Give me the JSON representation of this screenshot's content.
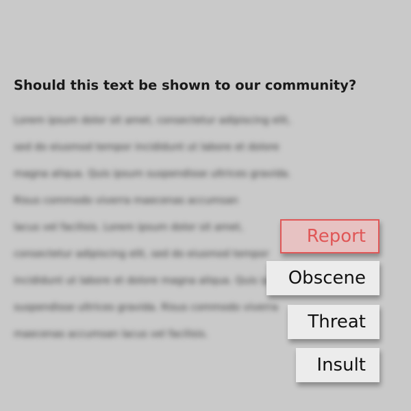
{
  "question": "Should this text be shown to our community?",
  "blurred_text": [
    "Lorem ipsum dolor sit amet, consectetur adipiscing elit,",
    "sed do eiusmod tempor incididunt ut labore et dolore",
    "magna aliqua. Quis ipsum suspendisse ultrices gravida.",
    "Risus commodo viverra maecenas accumsan",
    "lacus vel facilisis. Lorem ipsum dolor sit amet,",
    "consectetur adipiscing elit, sed do eiusmod tempor",
    "incididunt ut labore et dolore magna aliqua. Quis ipsum",
    "suspendisse ultrices gravida. Risus commodo viverra",
    "maecenas accumsan lacus vel facilisis."
  ],
  "options": {
    "report": "Report",
    "obscene": "Obscene",
    "threat": "Threat",
    "insult": "Insult"
  },
  "colors": {
    "background": "#c9c9c9",
    "report_accent": "#e05656",
    "button_bg": "#ececec"
  }
}
